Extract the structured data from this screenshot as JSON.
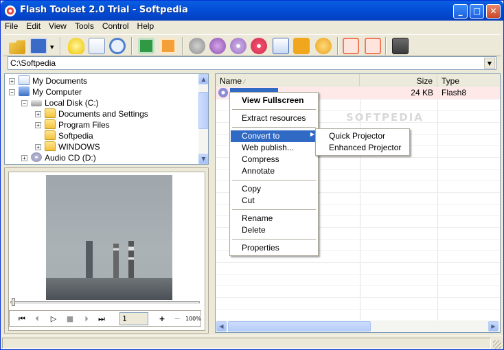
{
  "window": {
    "title": "Flash Toolset 2.0 Trial - Softpedia",
    "minimize": "_",
    "maximize": "□",
    "close": "✕"
  },
  "menubar": [
    "File",
    "Edit",
    "View",
    "Tools",
    "Control",
    "Help"
  ],
  "toolbar": {
    "icons": [
      "open-folder-icon",
      "view-mode-icon",
      "tip-bulb-icon",
      "export-icon",
      "search-icon",
      "crop-icon",
      "resize-icon",
      "gray-circle-icon",
      "purple-arrow-icon",
      "disc-icon",
      "flower-icon",
      "html-icon",
      "lock-icon",
      "download-icon",
      "arrow-out-icon",
      "link-icon",
      "news-icon"
    ]
  },
  "path": {
    "value": "C:\\Softpedia"
  },
  "tree": {
    "items": [
      {
        "label": "My Documents",
        "level": 0,
        "expander": "+",
        "icon": "my-documents-icon"
      },
      {
        "label": "My Computer",
        "level": 0,
        "expander": "−",
        "icon": "my-computer-icon"
      },
      {
        "label": "Local Disk (C:)",
        "level": 1,
        "expander": "−",
        "icon": "drive-icon"
      },
      {
        "label": "Documents and Settings",
        "level": 2,
        "expander": "+",
        "icon": "folder-icon"
      },
      {
        "label": "Program Files",
        "level": 2,
        "expander": "+",
        "icon": "folder-icon"
      },
      {
        "label": "Softpedia",
        "level": 2,
        "expander": "",
        "icon": "folder-icon"
      },
      {
        "label": "WINDOWS",
        "level": 2,
        "expander": "+",
        "icon": "folder-icon"
      },
      {
        "label": "Audio CD (D:)",
        "level": 1,
        "expander": "+",
        "icon": "cd-icon"
      }
    ]
  },
  "player": {
    "frame": "1",
    "zoom": "100%",
    "plus": "+",
    "minus": "−"
  },
  "filelist": {
    "columns": {
      "name": "Name",
      "sort": "⁄",
      "size": "Size",
      "type": "Type"
    },
    "rows": [
      {
        "name": "",
        "size": "24 KB",
        "type": "Flash8"
      }
    ],
    "watermark": "SOFTPEDIA"
  },
  "context_menu": {
    "items": [
      "View Fullscreen",
      "Extract resources",
      "Convert to",
      "Web publish...",
      "Compress",
      "Annotate",
      "Copy",
      "Cut",
      "Rename",
      "Delete",
      "Properties"
    ],
    "active": "Convert to"
  },
  "submenu": {
    "items": [
      "Quick Projector",
      "Enhanced Projector"
    ]
  }
}
